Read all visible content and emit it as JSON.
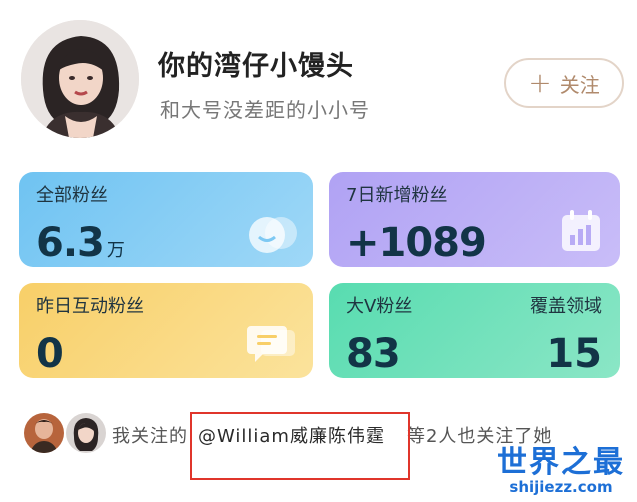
{
  "profile": {
    "name": "你的湾仔小馒头",
    "bio": "和大号没差距的小小号",
    "follow_label": "关注"
  },
  "stats": {
    "total_fans": {
      "label": "全部粉丝",
      "value": "6.3",
      "unit": "万"
    },
    "new_7d": {
      "label": "7日新增粉丝",
      "value": "+1089"
    },
    "interact_yesterday": {
      "label": "昨日互动粉丝",
      "value": "0"
    },
    "big_v": {
      "label": "大V粉丝",
      "value": "83",
      "domain_label": "覆盖领域",
      "domain_value": "15"
    }
  },
  "followers_footer": {
    "prefix": "我关注的",
    "mention": "@William威廉陈伟霆",
    "suffix": "等2人也关注了她"
  },
  "watermark": {
    "line1": "世界之最",
    "line2": "shijiezz.com"
  },
  "colors": {
    "card_blue": "#6fc3f2",
    "card_purple": "#b0a2f4",
    "card_yellow": "#f8cf68",
    "card_green": "#58dcb0",
    "follow_accent": "#b08a6c",
    "highlight": "#e0352b"
  }
}
